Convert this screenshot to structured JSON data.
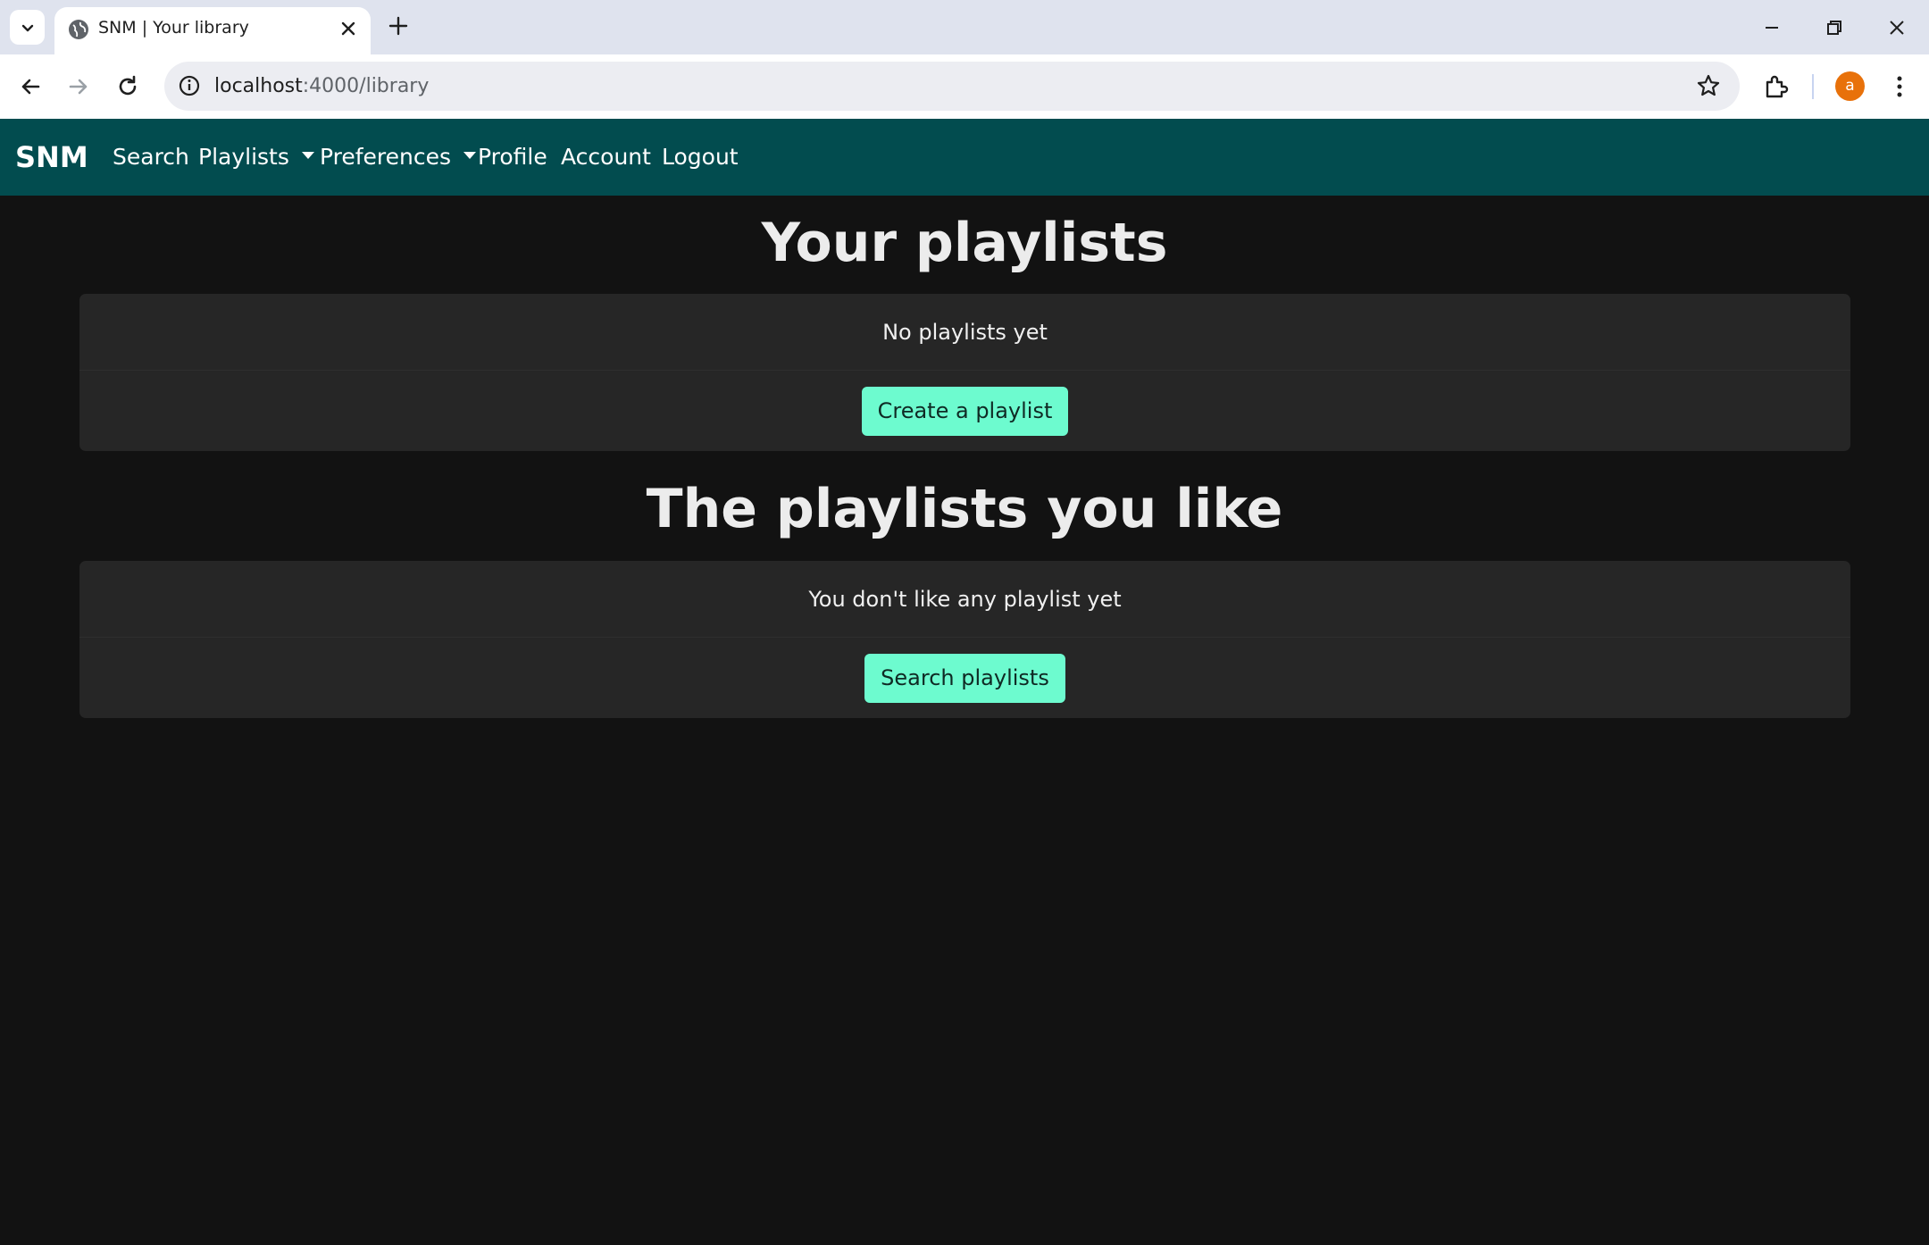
{
  "browser": {
    "tab_title": "SNM | Your library",
    "url_host": "localhost",
    "url_rest": ":4000/library",
    "profile_initial": "a"
  },
  "navbar": {
    "brand": "SNM",
    "links": [
      "Search",
      "Playlists",
      "Preferences",
      "Profile",
      "Account",
      "Logout"
    ]
  },
  "sections": [
    {
      "heading": "Your playlists",
      "empty_text": "No playlists yet",
      "button_label": "Create a playlist"
    },
    {
      "heading": "The playlists you like",
      "empty_text": "You don't like any playlist yet",
      "button_label": "Search playlists"
    }
  ],
  "colors": {
    "navbar_bg": "#024c4f",
    "page_bg": "#121212",
    "card_bg": "#262626",
    "button_bg": "#6dfbcf"
  }
}
